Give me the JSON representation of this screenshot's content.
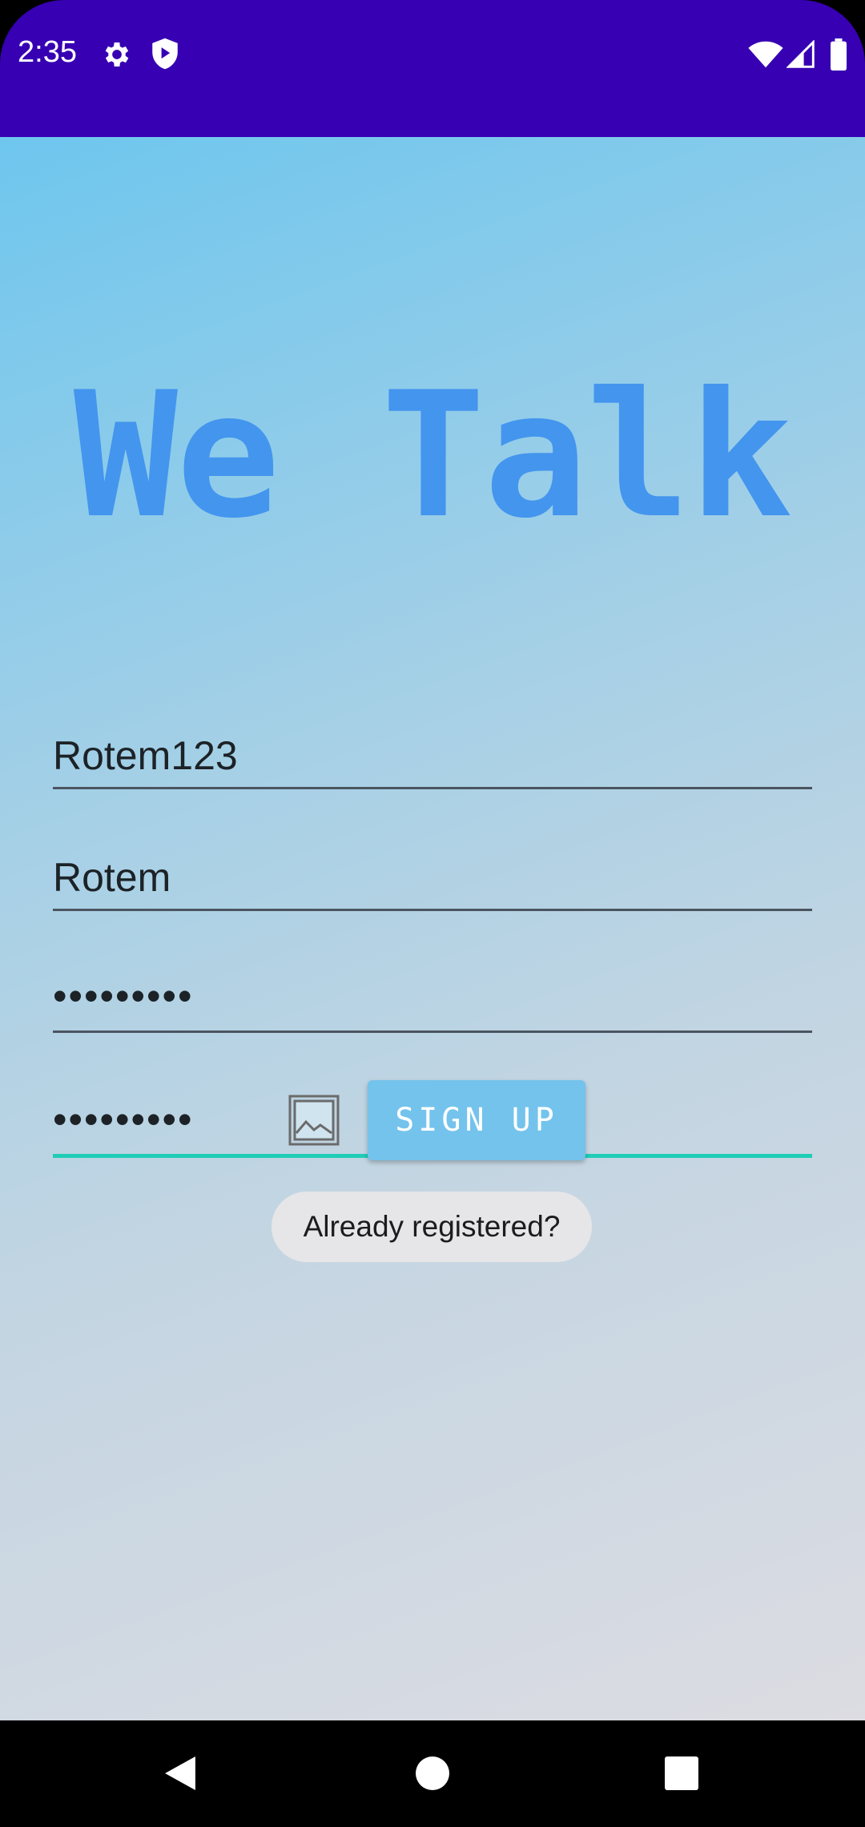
{
  "status_bar": {
    "time": "2:35",
    "icons": [
      "gear-icon",
      "shield-icon",
      "wifi-icon",
      "signal-icon",
      "battery-icon"
    ],
    "color": "#3700B3"
  },
  "app": {
    "title": "We Talk",
    "title_color": "#4395EE"
  },
  "form": {
    "username_value": "Rotem123",
    "name_value": "Rotem",
    "password_value": "•••••••••",
    "confirm_password_value": "•••••••••",
    "focused_field": "confirm_password",
    "accent_color": "#1fcdb6"
  },
  "image_picker": {
    "icon": "image-icon"
  },
  "buttons": {
    "signup_label": "SIGN UP",
    "signup_color": "#74c3ec",
    "login_label": "Already registered?"
  },
  "nav_bar": {
    "icons": [
      "back-icon",
      "home-icon",
      "recents-icon"
    ]
  }
}
